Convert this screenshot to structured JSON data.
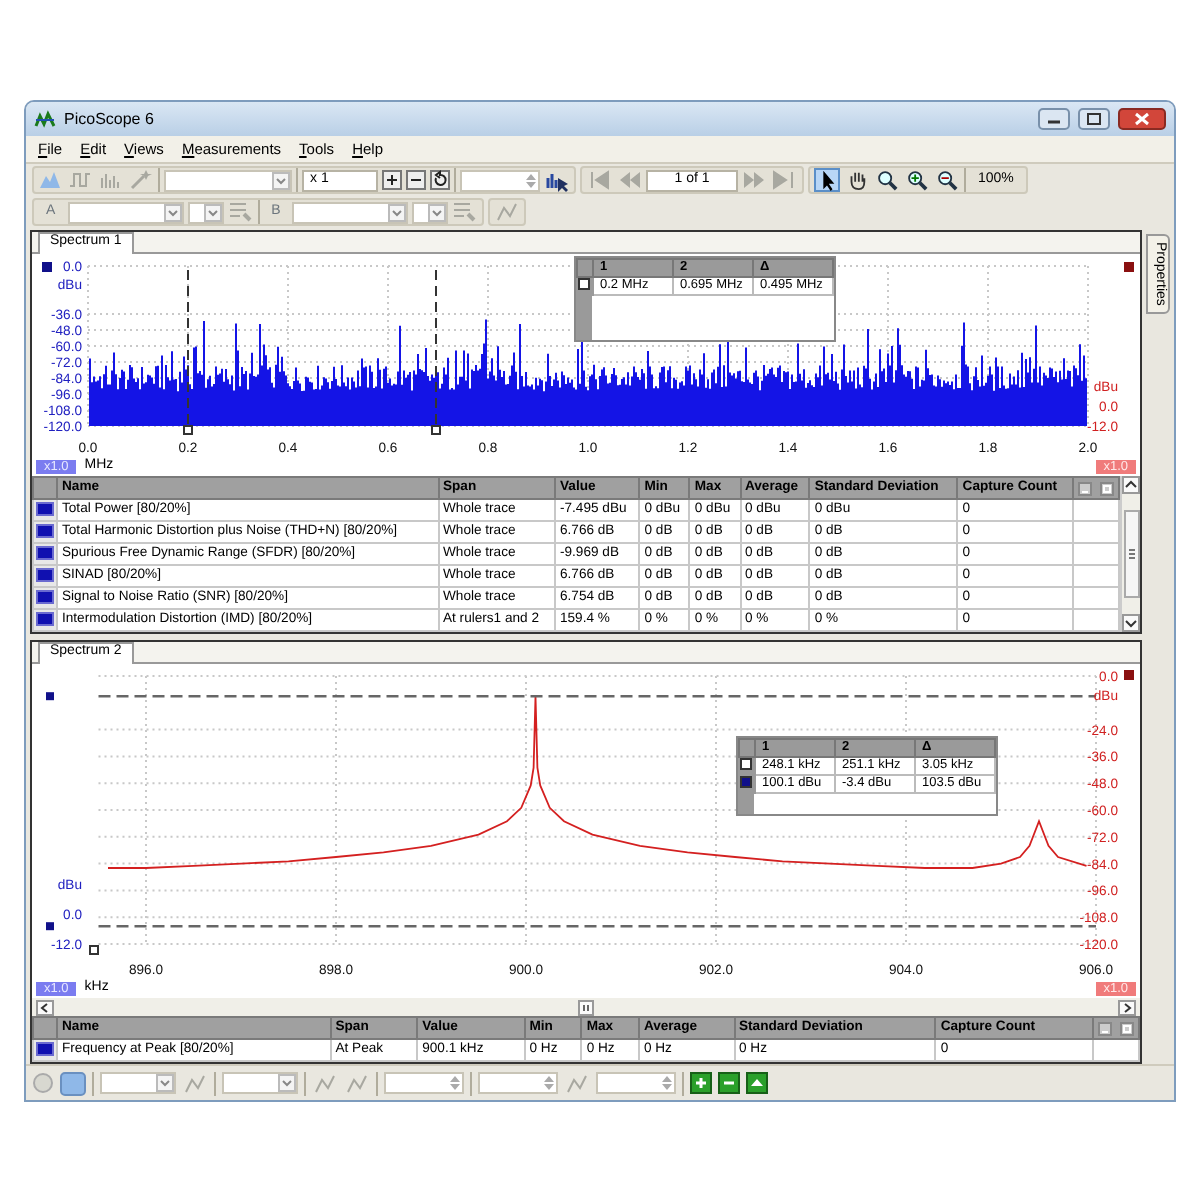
{
  "window": {
    "title": "PicoScope 6"
  },
  "menu": [
    "File",
    "Edit",
    "Views",
    "Measurements",
    "Tools",
    "Help"
  ],
  "toolbar": {
    "capture_multiplier": "x 1",
    "buffer_position": "1 of 1",
    "zoom_level": "100%",
    "tools": [
      {
        "selected": true
      },
      {
        "selected": false
      },
      {
        "selected": false
      },
      {
        "selected": false
      },
      {
        "selected": false
      }
    ]
  },
  "channel_bar": {
    "channel_a": "A",
    "channel_b": "B"
  },
  "views": [
    {
      "kind": "broadband",
      "tab": "Spectrum 1",
      "left_axis": {
        "labels": [
          "0.0",
          "dBu",
          "-36.0",
          "-48.0",
          "-60.0",
          "-72.0",
          "-84.0",
          "-96.0",
          "-108.0",
          "-120.0"
        ],
        "scale": "x1.0"
      },
      "right_axis": {
        "labels": [
          "dBu",
          "0.0",
          "-12.0"
        ],
        "scale": "x1.0"
      },
      "x_axis": {
        "unit": "MHz",
        "ticks": [
          "0.0",
          "0.2",
          "0.4",
          "0.6",
          "0.8",
          "1.0",
          "1.2",
          "1.4",
          "1.6",
          "1.8",
          "2.0"
        ]
      },
      "rulers": {
        "columns": [
          "1",
          "2",
          "Δ"
        ],
        "rows": [
          {
            "kind": "x_ruler",
            "cells": [
              "0.2 MHz",
              "0.695 MHz",
              "0.495 MHz"
            ]
          }
        ]
      },
      "measurements": {
        "columns": [
          "Name",
          "Span",
          "Value",
          "Min",
          "Max",
          "Average",
          "Standard Deviation",
          "Capture Count"
        ],
        "rows": [
          {
            "cells": [
              "Total Power  [80/20%]",
              "Whole trace",
              "-7.495 dBu",
              "0 dBu",
              "0 dBu",
              "0 dBu",
              "0 dBu",
              "0"
            ]
          },
          {
            "cells": [
              "Total Harmonic Distortion plus Noise (THD+N)  [80/20%]",
              "Whole trace",
              "6.766 dB",
              "0 dB",
              "0 dB",
              "0 dB",
              "0 dB",
              "0"
            ]
          },
          {
            "cells": [
              "Spurious Free Dynamic Range (SFDR)  [80/20%]",
              "Whole trace",
              "-9.969 dB",
              "0 dB",
              "0 dB",
              "0 dB",
              "0 dB",
              "0"
            ]
          },
          {
            "cells": [
              "SINAD  [80/20%]",
              "Whole trace",
              "6.766 dB",
              "0 dB",
              "0 dB",
              "0 dB",
              "0 dB",
              "0"
            ]
          },
          {
            "cells": [
              "Signal to Noise Ratio (SNR)  [80/20%]",
              "Whole trace",
              "6.754 dB",
              "0 dB",
              "0 dB",
              "0 dB",
              "0 dB",
              "0"
            ]
          },
          {
            "cells": [
              "Intermodulation Distortion (IMD)  [80/20%]",
              "At rulers1 and 2",
              "159.4 %",
              "0 %",
              "0 %",
              "0 %",
              "0 %",
              "0"
            ]
          }
        ]
      }
    },
    {
      "kind": "narrowband",
      "tab": "Spectrum 2",
      "left_axis": {
        "labels": [
          "dBu",
          "0.0",
          "-12.0"
        ],
        "scale": "x1.0"
      },
      "right_scale": "x1.0",
      "chart_data": {
        "type": "line",
        "xlabel": "kHz",
        "ylabel": "dBu",
        "xlim": [
          895.5,
          906
        ],
        "ylim": [
          -120,
          0
        ],
        "grid": true,
        "ref_lines": [
          {
            "axis": "y",
            "value": -9
          },
          {
            "axis": "y",
            "value": -112
          }
        ],
        "xticks": [
          {
            "value": 896,
            "label": "896.0"
          },
          {
            "value": 898,
            "label": "898.0"
          },
          {
            "value": 900,
            "label": "900.0"
          },
          {
            "value": 902,
            "label": "902.0"
          },
          {
            "value": 904,
            "label": "904.0"
          },
          {
            "value": 906,
            "label": "906.0"
          }
        ],
        "yticks": [
          {
            "value": 0,
            "label": "0.0"
          },
          {
            "value": -24,
            "label": "-24.0"
          },
          {
            "value": -36,
            "label": "-36.0"
          },
          {
            "value": -48,
            "label": "-48.0"
          },
          {
            "value": -60,
            "label": "-60.0"
          },
          {
            "value": -72,
            "label": "-72.0"
          },
          {
            "value": -84,
            "label": "-84.0"
          },
          {
            "value": -96,
            "label": "-96.0"
          },
          {
            "value": -108,
            "label": "-108.0"
          },
          {
            "value": -120,
            "label": "-120.0"
          }
        ],
        "x": [
          895.6,
          896.0,
          896.5,
          897.0,
          897.5,
          898.0,
          898.5,
          899.0,
          899.5,
          899.8,
          899.95,
          900.05,
          900.08,
          900.1,
          900.12,
          900.15,
          900.25,
          900.4,
          900.7,
          901.2,
          901.7,
          902.2,
          902.7,
          903.2,
          903.7,
          904.2,
          904.7,
          905.0,
          905.2,
          905.3,
          905.4,
          905.5,
          905.6,
          905.9
        ],
        "series": [
          {
            "color": "#d42020",
            "values": [
              -86,
              -86,
              -85,
              -84,
              -83,
              -81,
              -79,
              -76,
              -71,
              -65,
              -59,
              -49,
              -41,
              -9,
              -41,
              -49,
              -59,
              -65,
              -71,
              -76,
              -79,
              -81,
              -83,
              -84,
              -85,
              -86,
              -86,
              -84,
              -81,
              -76,
              -65,
              -76,
              -81,
              -85
            ]
          }
        ]
      },
      "rulers": {
        "columns": [
          "1",
          "2",
          "Δ"
        ],
        "rows": [
          {
            "kind": "x_ruler",
            "cells": [
              "248.1 kHz",
              "251.1 kHz",
              "3.05 kHz"
            ]
          },
          {
            "kind": "y_ruler",
            "cells": [
              "100.1 dBu",
              "-3.4 dBu",
              "103.5 dBu"
            ]
          }
        ]
      },
      "measurements": {
        "columns": [
          "Name",
          "Span",
          "Value",
          "Min",
          "Max",
          "Average",
          "Standard Deviation",
          "Capture Count"
        ],
        "rows": [
          {
            "cells": [
              "Frequency at Peak  [80/20%]",
              "At Peak",
              "900.1 kHz",
              "0 Hz",
              "0 Hz",
              "0 Hz",
              "0 Hz",
              "0"
            ]
          }
        ]
      }
    }
  ],
  "side_tab": "Properties"
}
